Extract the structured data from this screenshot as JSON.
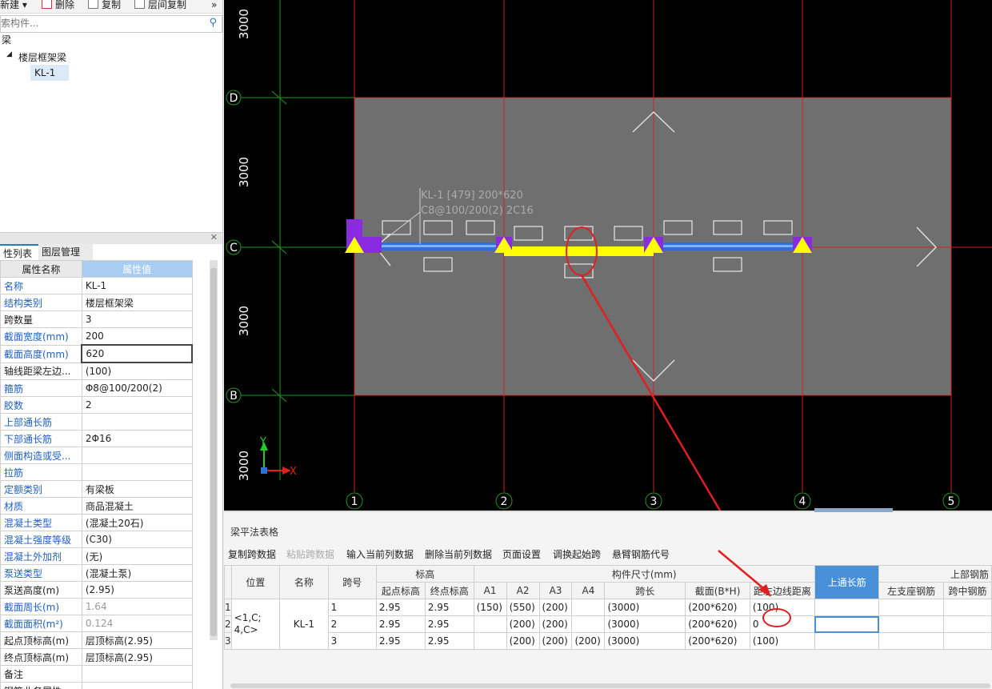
{
  "toolbar": {
    "new": "新建 ▾",
    "delete": "删除",
    "copy": "复制",
    "floor_copy": "层间复制",
    "more": "»"
  },
  "search": {
    "placeholder": "索构件..."
  },
  "tree": {
    "root": "梁",
    "group": "楼层框架梁",
    "item": "KL-1"
  },
  "tabs": {
    "props": "性列表",
    "layers": "图层管理"
  },
  "prop_table": {
    "header_name": "属性名称",
    "header_value": "属性值",
    "rows": [
      {
        "name": "名称",
        "value": "KL-1"
      },
      {
        "name": "结构类别",
        "value": "楼层框架梁"
      },
      {
        "name": "跨数量",
        "value": "3"
      },
      {
        "name": "截面宽度(mm)",
        "value": "200"
      },
      {
        "name": "截面高度(mm)",
        "value": "620"
      },
      {
        "name": "轴线距梁左边...",
        "value": "(100)"
      },
      {
        "name": "箍筋",
        "value": "Φ8@100/200(2)"
      },
      {
        "name": "胶数",
        "value": "2"
      },
      {
        "name": "上部通长筋",
        "value": ""
      },
      {
        "name": "下部通长筋",
        "value": "2Φ16"
      },
      {
        "name": "侧面构造或受...",
        "value": ""
      },
      {
        "name": "拉筋",
        "value": ""
      },
      {
        "name": "定额类别",
        "value": "有梁板"
      },
      {
        "name": "材质",
        "value": "商品混凝土"
      },
      {
        "name": "混凝土类型",
        "value": "(混凝土20石)"
      },
      {
        "name": "混凝土强度等级",
        "value": "(C30)"
      },
      {
        "name": "混凝土外加剂",
        "value": "(无)"
      },
      {
        "name": "泵送类型",
        "value": "(混凝土泵)"
      },
      {
        "name": "泵送高度(m)",
        "value": "(2.95)"
      },
      {
        "name": "截面周长(m)",
        "value": "1.64"
      },
      {
        "name": "截面面积(m²)",
        "value": "0.124"
      },
      {
        "name": "起点顶标高(m)",
        "value": "层顶标高(2.95)"
      },
      {
        "name": "终点顶标高(m)",
        "value": "层顶标高(2.95)"
      },
      {
        "name": "备注",
        "value": ""
      },
      {
        "name": "钢筋业务属性",
        "value": ""
      }
    ]
  },
  "canvas": {
    "dim_labels": [
      "3000",
      "3000",
      "3000",
      "3000"
    ],
    "axis_rows": [
      "D",
      "C",
      "B"
    ],
    "axis_cols": [
      "1",
      "2",
      "3",
      "4",
      "5"
    ],
    "beam_label_1": "KL-1 [479] 200*620",
    "beam_label_2": "C8@100/200(2) 2C16",
    "coord_y": "Y",
    "coord_x": "X",
    "colors": {
      "grid_red": "#cc2222",
      "grid_green": "#1f9a1f",
      "slab": "#6f6f6f",
      "beam_yellow": "#ffff00",
      "beam_blue": "#2f6fd8",
      "support": "#8a2be2",
      "annotation": "#e02020"
    }
  },
  "bottom": {
    "title": "梁平法表格",
    "buttons": [
      "复制跨数据",
      "粘贴跨数据",
      "输入当前列数据",
      "删除当前列数据",
      "页面设置",
      "调换起始跨",
      "悬臂钢筋代号"
    ],
    "headers": {
      "position": "位置",
      "name": "名称",
      "span_no": "跨号",
      "elevation": "标高",
      "start_elev": "起点标高",
      "end_elev": "终点标高",
      "dims": "构件尺寸(mm)",
      "a1": "A1",
      "a2": "A2",
      "a3": "A3",
      "a4": "A4",
      "span_len": "跨长",
      "section": "截面(B*H)",
      "offset": "距左边线距离",
      "top_long": "上通长筋",
      "top_rebar": "上部钢筋",
      "left_seat": "左支座钢筋",
      "mid_span": "跨中钢筋"
    },
    "row_nums": [
      "1",
      "2",
      "3"
    ],
    "position_value": "<1,C;\n4,C>",
    "name_value": "KL-1",
    "rows": [
      {
        "span": "1",
        "start": "2.95",
        "end": "2.95",
        "a1": "(150)",
        "a2": "(550)",
        "a3": "(200)",
        "a4": "",
        "len": "(3000)",
        "section": "(200*620)",
        "offset": "(100)"
      },
      {
        "span": "2",
        "start": "2.95",
        "end": "2.95",
        "a1": "",
        "a2": "(200)",
        "a3": "(200)",
        "a4": "",
        "len": "(3000)",
        "section": "(200*620)",
        "offset": "0"
      },
      {
        "span": "3",
        "start": "2.95",
        "end": "2.95",
        "a1": "",
        "a2": "(200)",
        "a3": "(200)",
        "a4": "(200)",
        "len": "(3000)",
        "section": "(200*620)",
        "offset": "(100)"
      }
    ]
  }
}
